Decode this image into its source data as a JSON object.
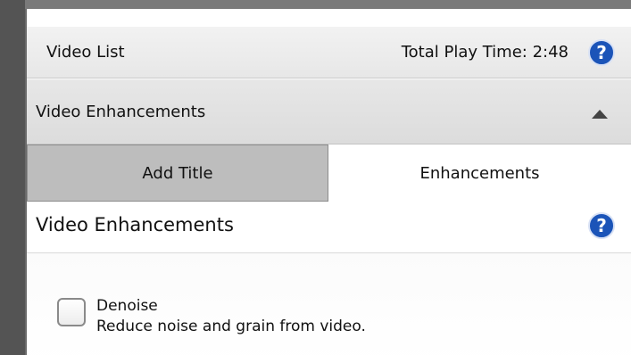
{
  "header": {
    "title": "Video List",
    "playtime": "Total Play Time: 2:48",
    "help_glyph": "?",
    "help_icon": "help-icon"
  },
  "section": {
    "title": "Video Enhancements",
    "collapse_icon": "triangle-up-icon"
  },
  "tabs": [
    {
      "label": "Add Title",
      "active": false
    },
    {
      "label": "Enhancements",
      "active": true
    }
  ],
  "panel": {
    "title": "Video Enhancements",
    "help_glyph": "?",
    "help_icon": "help-icon"
  },
  "options": [
    {
      "label": "Denoise",
      "description": "Reduce noise and grain from video.",
      "checked": false
    }
  ],
  "colors": {
    "help_blue": "#1b54b8",
    "inactive_tab": "#bdbdbd",
    "frame_dark": "#545454"
  }
}
